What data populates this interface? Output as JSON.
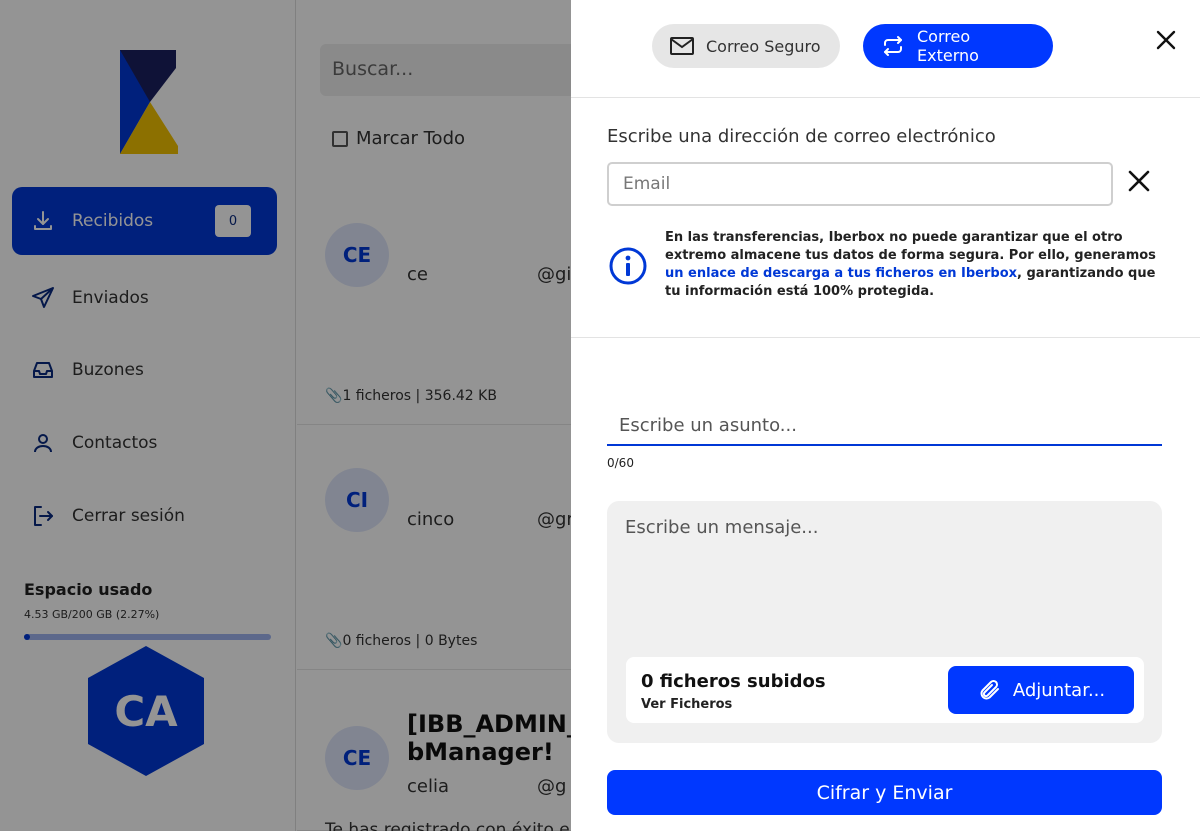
{
  "sidebar": {
    "items": [
      {
        "label": "Recibidos",
        "icon": "download-icon",
        "badge": "0",
        "active": true
      },
      {
        "label": "Enviados",
        "icon": "send-icon"
      },
      {
        "label": "Buzones",
        "icon": "inbox-icon"
      },
      {
        "label": "Contactos",
        "icon": "user-icon"
      },
      {
        "label": "Cerrar sesión",
        "icon": "logout-icon"
      }
    ],
    "usage": {
      "title": "Espacio usado",
      "text": "4.53 GB/200 GB (2.27%)",
      "fraction": 0.0227
    },
    "avatar_initials": "CA"
  },
  "list": {
    "search_placeholder": "Buscar...",
    "mark_all_label": "Marcar Todo",
    "messages": [
      {
        "initials": "CE",
        "from": "ce",
        "email": "@gi",
        "meta": "1 ficheros | 356.42 KB"
      },
      {
        "initials": "CI",
        "from": "cinco",
        "email": "@gr",
        "meta": "0 ficheros | 0 Bytes"
      },
      {
        "initials": "CE",
        "from": "celia",
        "email": "@g",
        "subject_line1": "[IBB_ADMIN_",
        "subject_line2": "bManager!",
        "snippet": "Te has registrado con éxito e"
      }
    ]
  },
  "panel": {
    "toggle_secure": "Correo Seguro",
    "toggle_external": "Correo Externo",
    "email_label": "Escribe una dirección de correo electrónico",
    "email_placeholder": "Email",
    "info_text_1": "En las transferencias, Iberbox no puede garantizar que el otro extremo almacene tus datos de forma segura. Por ello, generamos ",
    "info_link": "un enlace de descarga a tus ficheros en Iberbox",
    "info_text_2": ", garantizando que tu información está 100% protegida.",
    "subject_placeholder": "Escribe un asunto...",
    "subject_counter": "0/60",
    "message_placeholder": "Escribe un mensaje...",
    "files_count": "0 ficheros subidos",
    "files_view": "Ver Ficheros",
    "attach_label": "Adjuntar...",
    "send_label": "Cifrar y Enviar"
  },
  "colors": {
    "primary": "#0038ff",
    "nav_active": "#0038d6",
    "logo_navy": "#0a1a60",
    "logo_yellow": "#f2c200"
  }
}
